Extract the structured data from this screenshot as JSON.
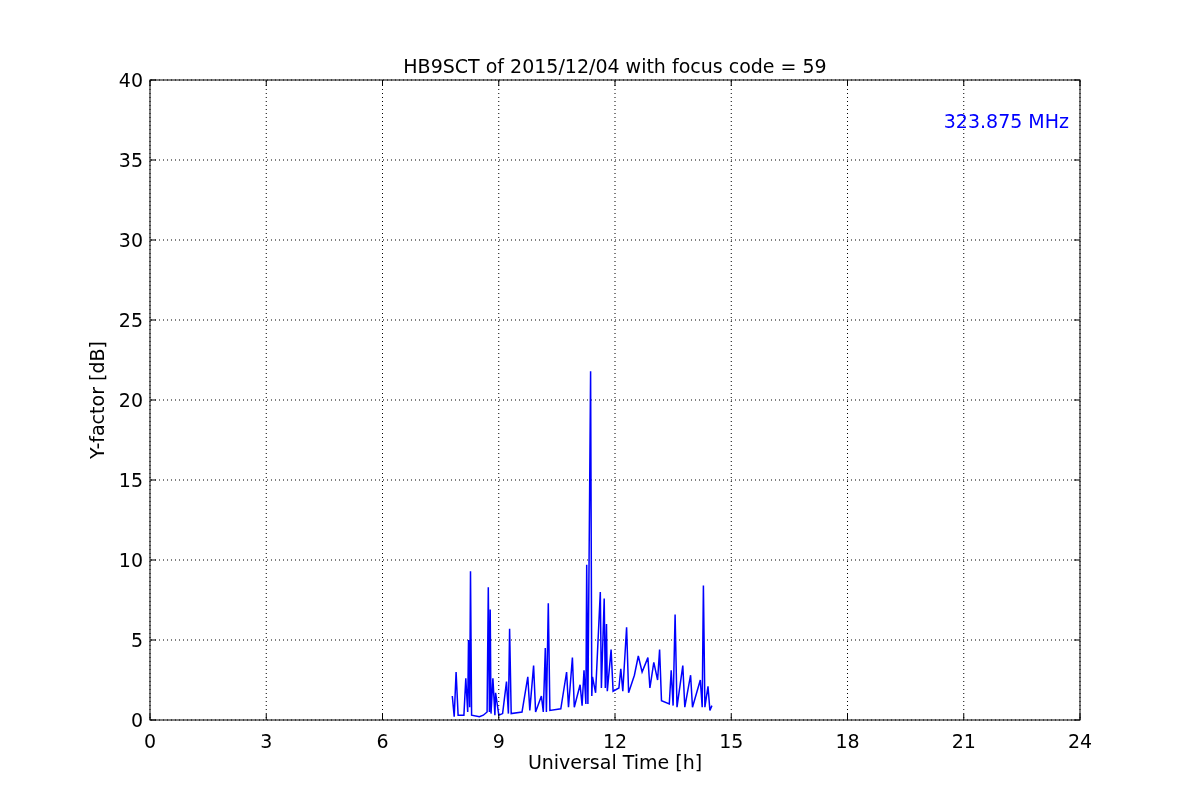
{
  "chart_data": {
    "type": "line",
    "title": "HB9SCT of 2015/12/04 with focus code = 59",
    "xlabel": "Universal Time [h]",
    "ylabel": "Y-factor [dB]",
    "xlim": [
      0,
      24
    ],
    "ylim": [
      0,
      40
    ],
    "xticks": [
      0,
      3,
      6,
      9,
      12,
      15,
      18,
      21,
      24
    ],
    "yticks": [
      0,
      5,
      10,
      15,
      20,
      25,
      30,
      35,
      40
    ],
    "grid": true,
    "annotations": [
      {
        "text": "323.875 MHz"
      }
    ],
    "x": [
      7.8,
      7.85,
      7.9,
      7.95,
      8.1,
      8.15,
      8.2,
      8.22,
      8.25,
      8.27,
      8.3,
      8.5,
      8.6,
      8.7,
      8.73,
      8.76,
      8.78,
      8.8,
      8.85,
      8.9,
      8.92,
      9.0,
      9.1,
      9.2,
      9.25,
      9.28,
      9.32,
      9.6,
      9.75,
      9.8,
      9.9,
      9.95,
      10.1,
      10.15,
      10.2,
      10.23,
      10.28,
      10.32,
      10.6,
      10.75,
      10.8,
      10.9,
      10.95,
      11.1,
      11.15,
      11.2,
      11.25,
      11.27,
      11.3,
      11.37,
      11.4,
      11.42,
      11.5,
      11.62,
      11.65,
      11.72,
      11.75,
      11.78,
      11.8,
      11.9,
      11.95,
      12.1,
      12.15,
      12.2,
      12.3,
      12.35,
      12.5,
      12.6,
      12.7,
      12.85,
      12.9,
      13.0,
      13.1,
      13.15,
      13.2,
      13.4,
      13.45,
      13.5,
      13.55,
      13.6,
      13.75,
      13.8,
      13.95,
      14.0,
      14.2,
      14.25,
      14.28,
      14.32,
      14.4,
      14.45,
      14.5
    ],
    "series": [
      {
        "color": "#0000ff",
        "values": [
          1.5,
          0.2,
          3.0,
          0.3,
          0.3,
          2.6,
          0.5,
          5.0,
          0.8,
          9.3,
          0.3,
          0.2,
          0.3,
          0.5,
          8.3,
          0.5,
          6.9,
          0.4,
          2.6,
          0.3,
          1.7,
          0.3,
          0.4,
          2.4,
          0.4,
          5.7,
          0.4,
          0.5,
          2.7,
          0.6,
          3.4,
          0.5,
          1.5,
          0.5,
          4.5,
          0.5,
          7.3,
          0.6,
          0.7,
          3.0,
          0.8,
          3.9,
          0.8,
          2.2,
          0.9,
          3.1,
          1.0,
          9.7,
          1.0,
          21.8,
          1.5,
          2.7,
          1.7,
          8.0,
          2.0,
          7.6,
          2.0,
          6.0,
          1.8,
          4.4,
          1.8,
          2.0,
          3.2,
          1.8,
          5.8,
          1.7,
          2.8,
          4.0,
          3.0,
          3.9,
          2.0,
          3.6,
          2.5,
          4.4,
          1.2,
          1.0,
          3.1,
          0.9,
          6.6,
          0.8,
          3.4,
          0.8,
          2.8,
          0.8,
          2.5,
          0.8,
          8.4,
          0.8,
          2.1,
          0.6,
          0.9
        ]
      }
    ]
  }
}
